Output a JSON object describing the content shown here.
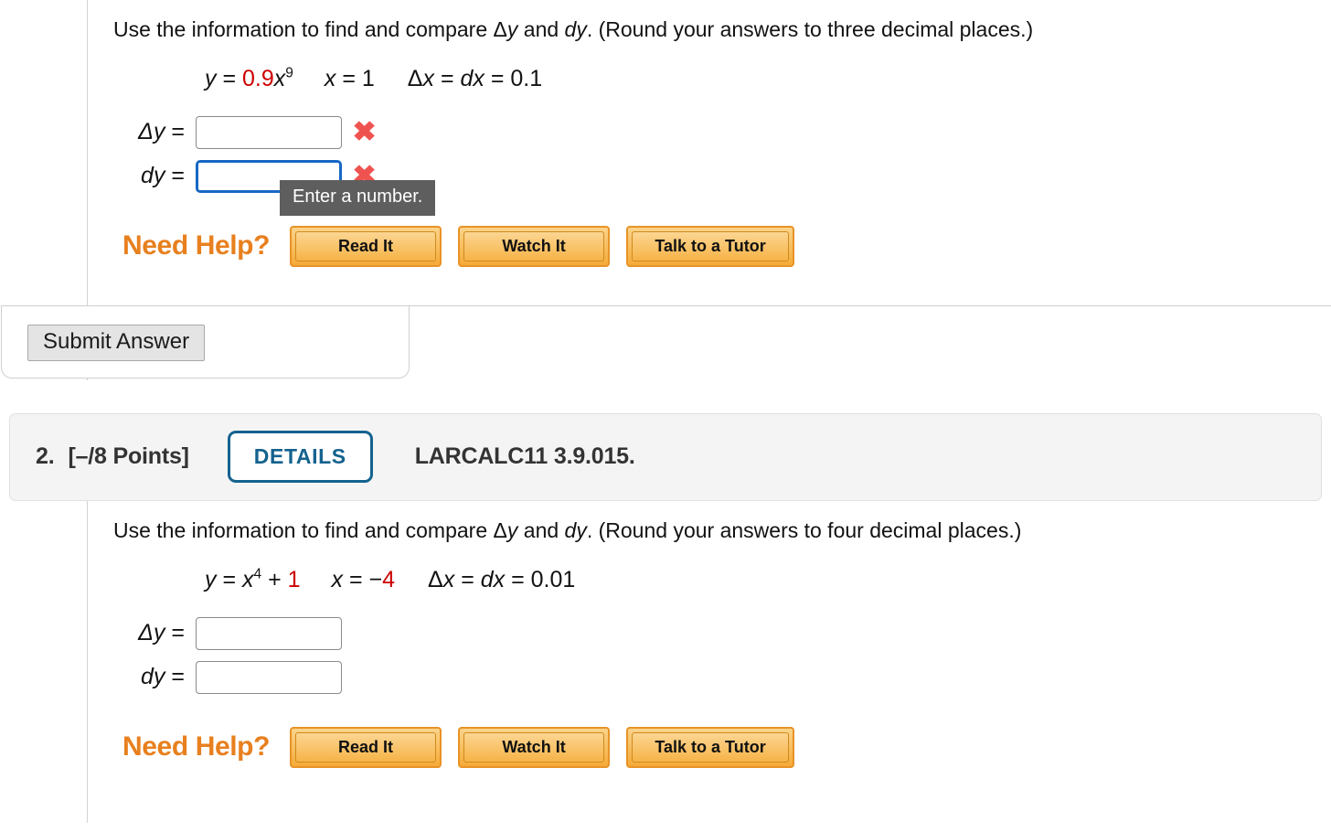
{
  "questions": [
    {
      "prompt_pre": "Use the information to find and compare ",
      "prompt_dy1": "y",
      "prompt_mid": " and ",
      "prompt_dy2": "dy",
      "prompt_post": ". (Round your answers to three decimal places.)",
      "formula": {
        "y_label": "y",
        "eq1": " = ",
        "coefficient": "0.9",
        "variable": "x",
        "exponent": "9",
        "x_label": "x",
        "eq2": " = ",
        "x_value": "1",
        "delta_x_label": "x",
        "dx_label": "dx",
        "dx_value": "0.1"
      },
      "answers": [
        {
          "label_delta": "y",
          "label_plain": "",
          "value": "",
          "focused": false,
          "mark": "✖"
        },
        {
          "label_delta": "",
          "label_plain": "dy",
          "value": "",
          "focused": true,
          "mark": "✖"
        }
      ],
      "tooltip": "Enter a number.",
      "need_help_label": "Need Help?",
      "help_buttons": [
        "Read It",
        "Watch It",
        "Talk to a Tutor"
      ],
      "submit_label": "Submit Answer"
    },
    {
      "header": {
        "number": "2.",
        "points": "[–/8 Points]",
        "details_label": "DETAILS",
        "code": "LARCALC11 3.9.015."
      },
      "prompt_pre": "Use the information to find and compare ",
      "prompt_dy1": "y",
      "prompt_mid": " and ",
      "prompt_dy2": "dy",
      "prompt_post": ". (Round your answers to four decimal places.)",
      "formula": {
        "y_label": "y",
        "eq1": " = ",
        "variable": "x",
        "exponent": "4",
        "plus": " + ",
        "constant": "1",
        "x_label": "x",
        "eq2": " = ",
        "x_sign": "−",
        "x_value": "4",
        "delta_x_label": "x",
        "dx_label": "dx",
        "dx_value": "0.01"
      },
      "answers": [
        {
          "label_delta": "y",
          "label_plain": "",
          "value": "",
          "focused": false,
          "mark": ""
        },
        {
          "label_delta": "",
          "label_plain": "dy",
          "value": "",
          "focused": false,
          "mark": ""
        }
      ],
      "need_help_label": "Need Help?",
      "help_buttons": [
        "Read It",
        "Watch It",
        "Talk to a Tutor"
      ]
    }
  ],
  "symbols": {
    "delta": "Δ",
    "equals": "=",
    "x_mark": "✖"
  },
  "colors": {
    "accent_orange": "#e8801f",
    "red_value": "#cc0000",
    "details_blue": "#14628e",
    "focus_blue": "#1668c5",
    "x_mark_red": "#ef5350",
    "tooltip_bg": "#5e5e5e"
  }
}
